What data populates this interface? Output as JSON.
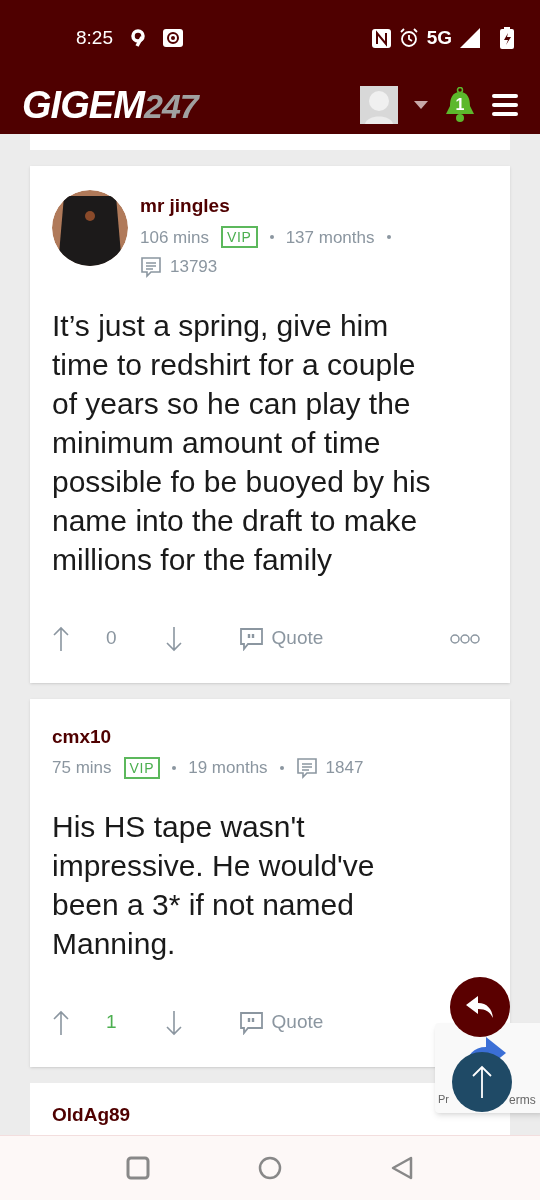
{
  "status_bar": {
    "time": "8:25",
    "network": "5G"
  },
  "header": {
    "logo_main": "GIGEM",
    "logo_num": "247",
    "notification_count": "1"
  },
  "posts": [
    {
      "author": "mr jingles",
      "has_avatar": true,
      "age": "106 mins",
      "badge": "VIP",
      "tenure": "137 months",
      "post_count": "13793",
      "body": "It’s just a spring, give him time to redshirt for a couple of years so he can play the minimum amount of time possible fo be buoyed by his name into the draft to make millions for the family",
      "score": "0",
      "score_positive": false,
      "quote": "Quote",
      "has_more": true
    },
    {
      "author": "cmx10",
      "has_avatar": false,
      "age": "75 mins",
      "badge": "VIP",
      "tenure": "19 months",
      "post_count": "1847",
      "body": "His HS tape wasn't impressive. He would've been a 3* if not named Manning.",
      "score": "1",
      "score_positive": true,
      "quote": "Quote",
      "has_more": false
    },
    {
      "author": "OldAg89",
      "has_avatar": false
    }
  ],
  "recaptcha": {
    "text_left": "Pr",
    "text_right": "erms"
  }
}
